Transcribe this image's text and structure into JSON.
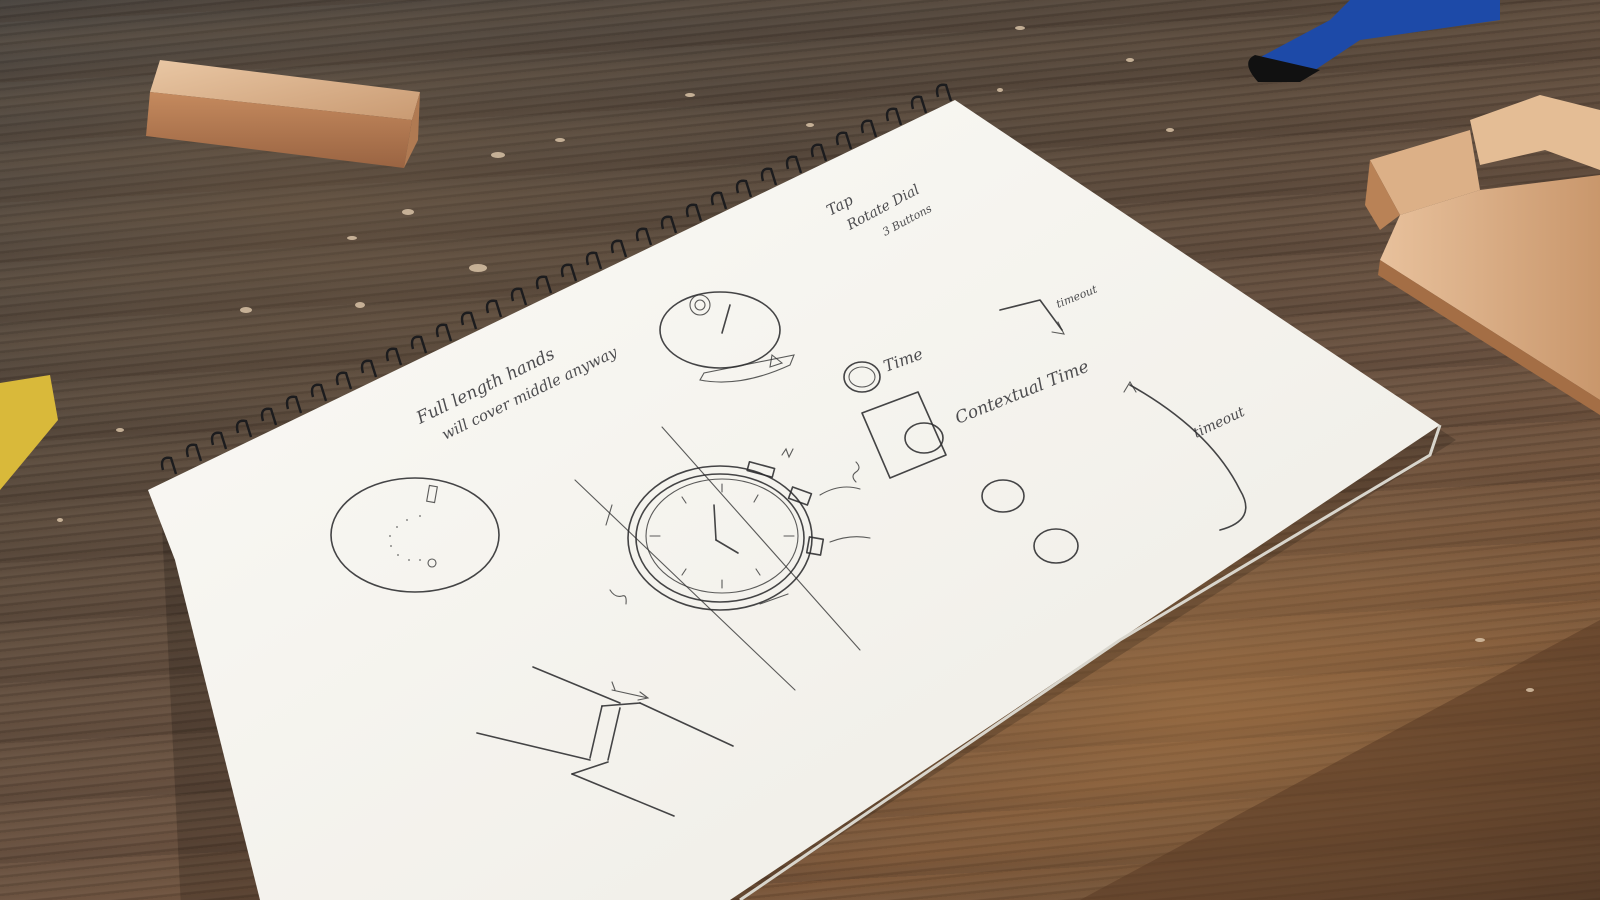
{
  "notes": {
    "line1": "Full length hands",
    "line2": "will cover middle anyway",
    "tap": "Tap",
    "rotate_dial": "Rotate Dial",
    "buttons": "3 Buttons",
    "time": "Time",
    "contextual_time": "Contextual Time",
    "timeout_upper": "timeout",
    "timeout_lower": "timeout"
  },
  "colors": {
    "paper": "#f7f6f1",
    "pencil": "#2b2b2e",
    "wood_light": "#d9b48f",
    "table_dark": "#4a4540",
    "spiral": "#1c1c1e",
    "sandpaper": "#d9b93a",
    "clamp_blue": "#1d4aa8"
  }
}
